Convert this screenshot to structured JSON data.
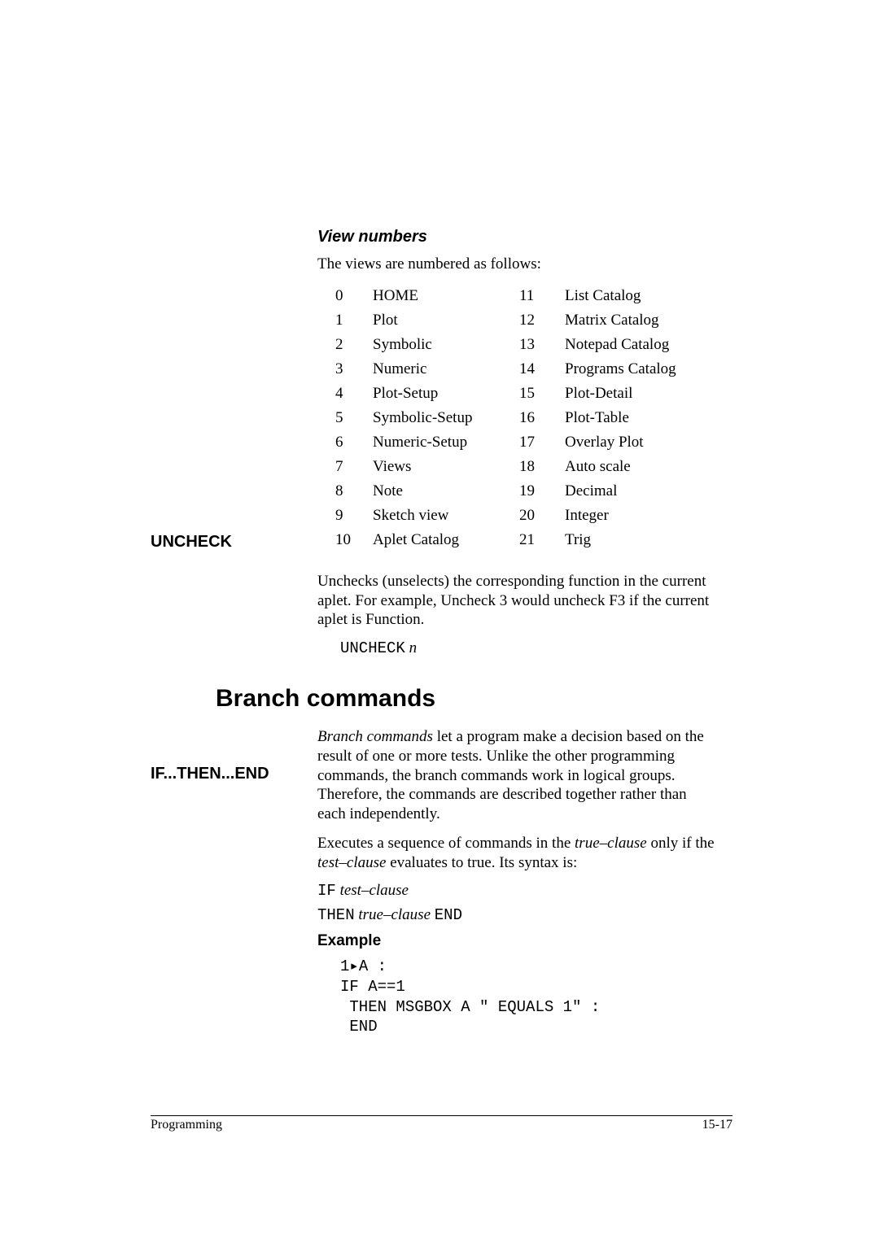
{
  "viewNumbers": {
    "heading": "View numbers",
    "intro": "The views are numbered as follows:",
    "rows": [
      {
        "a": "0",
        "b": "HOME",
        "c": "11",
        "d": "List Catalog"
      },
      {
        "a": "1",
        "b": "Plot",
        "c": "12",
        "d": "Matrix Catalog"
      },
      {
        "a": "2",
        "b": "Symbolic",
        "c": "13",
        "d": "Notepad Catalog"
      },
      {
        "a": "3",
        "b": "Numeric",
        "c": "14",
        "d": "Programs Catalog"
      },
      {
        "a": "4",
        "b": "Plot-Setup",
        "c": "15",
        "d": "Plot-Detail"
      },
      {
        "a": "5",
        "b": "Symbolic-Setup",
        "c": "16",
        "d": "Plot-Table"
      },
      {
        "a": "6",
        "b": "Numeric-Setup",
        "c": "17",
        "d": "Overlay Plot"
      },
      {
        "a": "7",
        "b": "Views",
        "c": "18",
        "d": "Auto scale"
      },
      {
        "a": "8",
        "b": "Note",
        "c": "19",
        "d": "Decimal"
      },
      {
        "a": "9",
        "b": "Sketch view",
        "c": "20",
        "d": "Integer"
      },
      {
        "a": "10",
        "b": "Aplet Catalog",
        "c": "21",
        "d": "Trig"
      }
    ]
  },
  "uncheck": {
    "label": "UNCHECK",
    "text": "Unchecks (unselects) the corresponding function in the current aplet. For example, Uncheck 3 would uncheck F3 if the current aplet is Function.",
    "syntax_cmd": "UNCHECK",
    "syntax_arg": "n"
  },
  "branch": {
    "heading": "Branch commands",
    "intro_emph": "Branch commands",
    "intro_rest": " let a program make a decision based on the result of one or more tests. Unlike the other programming commands, the branch commands work in logical groups. Therefore, the commands are described together rather than each independently."
  },
  "ifthen": {
    "label": "IF...THEN...END",
    "text_pre": "Executes a sequence of commands in the ",
    "text_tc": "true–clause",
    "text_mid": " only if the ",
    "text_test": "test–clause",
    "text_post": " evaluates to true. Its syntax is:",
    "line1_cmd": "IF",
    "line1_arg": "test–clause",
    "line2_cmd1": "THEN",
    "line2_arg": "true–clause",
    "line2_cmd2": "END",
    "example_heading": "Example",
    "code": "1▸A :\nIF A==1\n THEN MSGBOX A \" EQUALS 1\" :\n END"
  },
  "footer": {
    "left": "Programming",
    "right": "15-17"
  }
}
